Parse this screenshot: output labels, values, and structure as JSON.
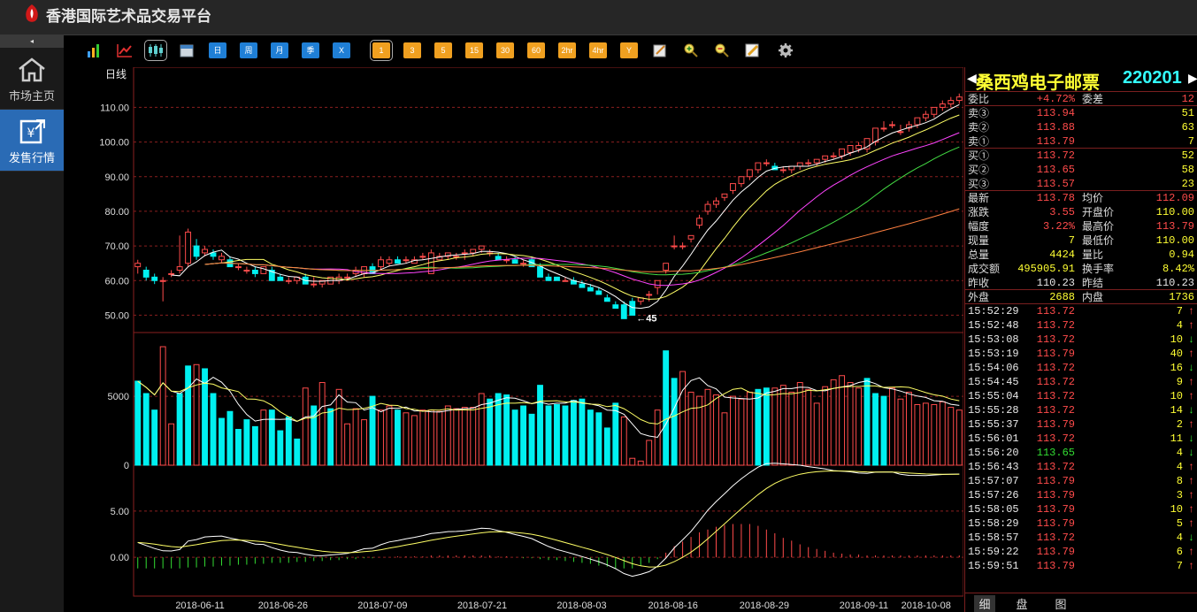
{
  "app": {
    "title": "香港国际艺术品交易平台"
  },
  "sidebar": {
    "collapse": "◂",
    "items": [
      {
        "label": "市场主页",
        "icon": "home-icon"
      },
      {
        "label": "发售行情",
        "icon": "issue-quote-icon"
      }
    ]
  },
  "toolbar": {
    "icons": [
      "bar-chart-icon",
      "line-chart-icon",
      "candlestick-icon",
      "calendar-icon"
    ],
    "periods": [
      "日",
      "周",
      "月",
      "季",
      "X"
    ],
    "minutes": [
      "1",
      "3",
      "5",
      "15",
      "30",
      "60",
      "2hr",
      "4hr",
      "Y"
    ],
    "tools": [
      "draw-icon",
      "zoom-in-icon",
      "zoom-out-icon",
      "pencil-icon",
      "gear-icon"
    ]
  },
  "chart_data": {
    "type": "candlestick",
    "period_label": "日线",
    "price_axis": {
      "ticks": [
        "110.00",
        "100.00",
        "90.00",
        "80.00",
        "70.00",
        "60.00",
        "50.00"
      ],
      "ylim": [
        45,
        117
      ]
    },
    "low_marker": "45",
    "volume_axis": {
      "ticks": [
        "5000",
        "0"
      ]
    },
    "macd_axis": {
      "ticks": [
        "5.00",
        "0.00"
      ]
    },
    "dates": [
      "2018-06-11",
      "2018-06-26",
      "2018-07-09",
      "2018-07-21",
      "2018-08-03",
      "2018-08-16",
      "2018-08-29",
      "2018-09-11",
      "2018-10-08"
    ],
    "candles": [
      [
        64,
        66,
        62,
        65
      ],
      [
        63,
        64,
        60,
        61
      ],
      [
        61,
        62,
        59,
        60
      ],
      [
        60,
        61,
        54,
        60
      ],
      [
        62,
        63,
        61,
        62
      ],
      [
        63,
        73,
        62,
        64
      ],
      [
        65,
        75,
        64,
        74
      ],
      [
        70,
        72,
        66,
        67
      ],
      [
        68,
        70,
        67,
        69
      ],
      [
        68,
        69,
        66,
        67
      ],
      [
        66,
        68,
        65,
        67
      ],
      [
        66,
        67,
        64,
        64
      ],
      [
        64,
        65,
        63,
        64
      ],
      [
        63,
        64,
        62,
        63
      ],
      [
        63,
        64,
        61,
        62
      ],
      [
        62,
        64,
        62,
        64
      ],
      [
        63,
        64,
        60,
        60
      ],
      [
        61,
        62,
        60,
        60
      ],
      [
        60,
        61,
        59,
        60
      ],
      [
        60,
        61,
        59,
        61
      ],
      [
        61,
        62,
        59,
        59
      ],
      [
        59,
        61,
        58,
        59
      ],
      [
        59,
        60,
        58,
        60
      ],
      [
        59,
        61,
        59,
        61
      ],
      [
        60,
        62,
        59,
        61
      ],
      [
        61,
        62,
        60,
        61
      ],
      [
        62,
        64,
        61,
        63
      ],
      [
        62,
        64,
        61,
        64
      ],
      [
        64,
        65,
        62,
        62
      ],
      [
        64,
        67,
        63,
        66
      ],
      [
        65,
        67,
        64,
        66
      ],
      [
        66,
        67,
        65,
        65
      ],
      [
        66,
        67,
        65,
        66
      ],
      [
        65,
        67,
        65,
        66
      ],
      [
        67,
        68,
        66,
        67
      ],
      [
        62,
        69,
        62,
        68
      ],
      [
        66,
        68,
        66,
        67
      ],
      [
        67,
        68,
        66,
        68
      ],
      [
        67,
        68,
        66,
        67
      ],
      [
        68,
        69,
        66,
        68
      ],
      [
        68,
        69,
        67,
        69
      ],
      [
        69,
        70,
        68,
        70
      ],
      [
        68,
        69,
        67,
        68
      ],
      [
        67,
        68,
        66,
        66
      ],
      [
        66,
        67,
        65,
        66
      ],
      [
        66,
        67,
        65,
        65
      ],
      [
        65,
        66,
        64,
        65
      ],
      [
        66,
        67,
        64,
        64
      ],
      [
        64,
        65,
        61,
        61
      ],
      [
        61,
        62,
        60,
        60
      ],
      [
        61,
        61,
        60,
        60
      ],
      [
        60,
        61,
        60,
        60
      ],
      [
        60,
        61,
        59,
        59
      ],
      [
        59,
        60,
        58,
        58
      ],
      [
        58,
        59,
        57,
        57
      ],
      [
        57,
        58,
        56,
        56
      ],
      [
        55,
        56,
        54,
        54
      ],
      [
        53,
        54,
        52,
        52
      ],
      [
        53,
        54,
        49,
        49
      ],
      [
        54,
        55,
        50,
        50
      ],
      [
        54,
        55,
        53,
        55
      ],
      [
        56,
        57,
        54,
        56
      ],
      [
        58,
        60,
        56,
        60
      ],
      [
        63,
        65,
        62,
        65
      ],
      [
        70,
        73,
        69,
        70
      ],
      [
        70,
        71,
        69,
        70
      ],
      [
        72,
        73,
        71,
        73
      ],
      [
        76,
        79,
        75,
        78
      ],
      [
        80,
        83,
        79,
        82
      ],
      [
        82,
        84,
        81,
        83
      ],
      [
        84,
        85,
        83,
        85
      ],
      [
        86,
        88,
        85,
        88
      ],
      [
        88,
        90,
        87,
        90
      ],
      [
        90,
        92,
        89,
        92
      ],
      [
        92,
        94,
        91,
        94
      ],
      [
        94,
        95,
        93,
        94
      ],
      [
        93,
        94,
        92,
        92
      ],
      [
        92,
        93,
        91,
        92
      ],
      [
        92,
        93,
        91,
        93
      ],
      [
        93,
        94,
        92,
        94
      ],
      [
        94,
        95,
        93,
        94
      ],
      [
        94,
        95,
        93,
        95
      ],
      [
        95,
        96,
        94,
        96
      ],
      [
        96,
        97,
        95,
        96
      ],
      [
        96,
        98,
        95,
        98
      ],
      [
        97,
        99,
        96,
        99
      ],
      [
        98,
        100,
        97,
        99
      ],
      [
        98,
        101,
        97,
        101
      ],
      [
        100,
        104,
        99,
        104
      ],
      [
        104,
        106,
        103,
        104
      ],
      [
        105,
        106,
        104,
        105
      ],
      [
        103,
        105,
        102,
        103
      ],
      [
        104,
        106,
        103,
        105
      ],
      [
        105,
        107,
        104,
        107
      ],
      [
        107,
        109,
        106,
        108
      ],
      [
        108,
        110,
        107,
        110
      ],
      [
        110,
        112,
        109,
        111
      ],
      [
        111,
        113,
        110,
        112
      ],
      [
        112,
        114,
        111,
        113
      ]
    ],
    "volumes": [
      6100,
      5200,
      4000,
      8600,
      3000,
      5200,
      7200,
      7300,
      7000,
      5200,
      3400,
      3900,
      2600,
      3300,
      2800,
      4000,
      4000,
      2500,
      3500,
      1900,
      5600,
      4300,
      6000,
      4100,
      5500,
      3000,
      4100,
      3300,
      5000,
      4000,
      4300,
      4000,
      3800,
      3600,
      4000,
      4000,
      3900,
      4300,
      4100,
      4200,
      4200,
      5200,
      4800,
      5200,
      5100,
      4000,
      4300,
      3700,
      5800,
      4300,
      4400,
      4300,
      4700,
      4800,
      4000,
      3800,
      2700,
      4500,
      3500,
      500,
      300,
      1800,
      4000,
      8300,
      6300,
      6800,
      5300,
      5000,
      5500,
      5100,
      3800,
      5000,
      4800,
      5300,
      5500,
      5600,
      5600,
      5800,
      5300,
      6000,
      5500,
      4500,
      5700,
      6200,
      6500,
      6000,
      5600,
      6300,
      5200,
      5000,
      5600,
      4800,
      5300,
      4400,
      4500,
      4400,
      4600,
      4200,
      4000
    ],
    "volume_up": [
      false,
      false,
      false,
      true,
      true,
      false,
      false,
      true,
      false,
      false,
      false,
      false,
      false,
      false,
      false,
      true,
      false,
      false,
      false,
      false,
      true,
      false,
      true,
      false,
      true,
      true,
      true,
      true,
      false,
      true,
      true,
      false,
      true,
      true,
      true,
      true,
      true,
      true,
      true,
      true,
      true,
      true,
      false,
      false,
      false,
      false,
      false,
      false,
      false,
      false,
      false,
      false,
      false,
      false,
      false,
      false,
      false,
      false,
      true,
      true,
      true,
      true,
      true,
      false,
      false,
      true,
      true,
      true,
      true,
      true,
      true,
      true,
      true,
      true,
      false,
      false,
      true,
      true,
      true,
      true,
      true,
      true,
      true,
      true,
      true,
      true,
      true,
      false,
      false,
      false,
      true,
      true,
      true,
      true,
      true,
      true,
      true,
      true,
      true
    ],
    "macd_hist": [
      -1.2,
      -1.2,
      -1.2,
      -1.2,
      -1.2,
      -1.2,
      -1.1,
      -1.1,
      -1.0,
      -1.0,
      -0.9,
      -0.9,
      -0.8,
      -0.8,
      -0.7,
      -0.7,
      -0.6,
      -0.6,
      -0.6,
      -0.5,
      -0.5,
      -0.4,
      -0.4,
      -0.3,
      -0.3,
      -0.2,
      -0.2,
      -0.1,
      -0.1,
      0.0,
      0.0,
      0.1,
      0.1,
      0.1,
      0.1,
      0.2,
      0.2,
      0.2,
      0.2,
      0.2,
      0.2,
      0.2,
      0.2,
      0.1,
      0.1,
      0.0,
      -0.1,
      -0.1,
      -0.2,
      -0.3,
      -0.3,
      -0.4,
      -0.5,
      -0.6,
      -0.7,
      -0.9,
      -1.0,
      -1.2,
      -1.2,
      -1.2,
      -0.9,
      -0.6,
      -0.2,
      0.5,
      1.2,
      1.7,
      2.2,
      2.7,
      3.0,
      3.3,
      3.5,
      3.6,
      3.6,
      3.6,
      3.4,
      3.0,
      2.6,
      2.1,
      1.8,
      1.4,
      1.1,
      0.9,
      0.7,
      0.5,
      0.4,
      0.3,
      0.3,
      0.2,
      0.2,
      0.2,
      0.2,
      0.2,
      0.2,
      0.2,
      0.2,
      0.2,
      0.2,
      0.2,
      0.2
    ]
  },
  "quote": {
    "name": "桑西鸡电子邮票",
    "code": "220201",
    "rows": [
      {
        "l1": "委比",
        "v1": "+4.72%",
        "l2": "委差",
        "v2": "12",
        "c1": "red",
        "c2": "red",
        "sep": true
      },
      {
        "l1": "卖③",
        "v1": "113.94",
        "v2": "51",
        "c1": "red",
        "c2": "yel"
      },
      {
        "l1": "卖②",
        "v1": "113.88",
        "v2": "63",
        "c1": "red",
        "c2": "yel"
      },
      {
        "l1": "卖①",
        "v1": "113.79",
        "v2": "7",
        "c1": "red",
        "c2": "yel",
        "sep": true
      },
      {
        "l1": "买①",
        "v1": "113.72",
        "v2": "52",
        "c1": "red",
        "c2": "yel"
      },
      {
        "l1": "买②",
        "v1": "113.65",
        "v2": "58",
        "c1": "red",
        "c2": "yel"
      },
      {
        "l1": "买③",
        "v1": "113.57",
        "v2": "23",
        "c1": "red",
        "c2": "yel",
        "sep": true
      },
      {
        "l1": "最新",
        "v1": "113.78",
        "l2": "均价",
        "v2": "112.09",
        "c1": "red",
        "c2": "red"
      },
      {
        "l1": "涨跌",
        "v1": "3.55",
        "l2": "开盘价",
        "v2": "110.00",
        "c1": "red",
        "c2": "yel"
      },
      {
        "l1": "幅度",
        "v1": "3.22%",
        "l2": "最高价",
        "v2": "113.79",
        "c1": "red",
        "c2": "red"
      },
      {
        "l1": "现量",
        "v1": "7",
        "l2": "最低价",
        "v2": "110.00",
        "c1": "yel",
        "c2": "yel"
      },
      {
        "l1": "总量",
        "v1": "4424",
        "l2": "量比",
        "v2": "0.94",
        "c1": "yel",
        "c2": "yel"
      },
      {
        "l1": "成交额",
        "v1": "495905.91",
        "l2": "换手率",
        "v2": "8.42%",
        "c1": "yel",
        "c2": "yel"
      },
      {
        "l1": "昨收",
        "v1": "110.23",
        "l2": "昨结",
        "v2": "110.23",
        "c1": "wht",
        "c2": "wht",
        "sep": true
      },
      {
        "l1": "外盘",
        "v1": "2688",
        "l2": "内盘",
        "v2": "1736",
        "c1": "yel",
        "c2": "yel",
        "sep": true
      }
    ],
    "ticks": [
      {
        "t": "15:52:29",
        "p": "113.72",
        "q": "7",
        "d": "↑"
      },
      {
        "t": "15:52:48",
        "p": "113.72",
        "q": "4",
        "d": "↑"
      },
      {
        "t": "15:53:08",
        "p": "113.72",
        "q": "10",
        "d": "↓"
      },
      {
        "t": "15:53:19",
        "p": "113.79",
        "q": "40",
        "d": "↑"
      },
      {
        "t": "15:54:06",
        "p": "113.72",
        "q": "16",
        "d": "↓"
      },
      {
        "t": "15:54:45",
        "p": "113.72",
        "q": "9",
        "d": "↑"
      },
      {
        "t": "15:55:04",
        "p": "113.72",
        "q": "10",
        "d": "↑"
      },
      {
        "t": "15:55:28",
        "p": "113.72",
        "q": "14",
        "d": "↓"
      },
      {
        "t": "15:55:37",
        "p": "113.79",
        "q": "2",
        "d": "↑"
      },
      {
        "t": "15:56:01",
        "p": "113.72",
        "q": "11",
        "d": "↓"
      },
      {
        "t": "15:56:20",
        "p": "113.65",
        "q": "4",
        "d": "↓"
      },
      {
        "t": "15:56:43",
        "p": "113.72",
        "q": "4",
        "d": "↑"
      },
      {
        "t": "15:57:07",
        "p": "113.79",
        "q": "8",
        "d": "↑"
      },
      {
        "t": "15:57:26",
        "p": "113.79",
        "q": "3",
        "d": "↑"
      },
      {
        "t": "15:58:05",
        "p": "113.79",
        "q": "10",
        "d": "↑"
      },
      {
        "t": "15:58:29",
        "p": "113.79",
        "q": "5",
        "d": "↑"
      },
      {
        "t": "15:58:57",
        "p": "113.72",
        "q": "4",
        "d": "↓"
      },
      {
        "t": "15:59:22",
        "p": "113.79",
        "q": "6",
        "d": "↑"
      },
      {
        "t": "15:59:51",
        "p": "113.79",
        "q": "7",
        "d": "↑"
      }
    ],
    "tabs": [
      "细",
      "盘",
      "图"
    ]
  }
}
